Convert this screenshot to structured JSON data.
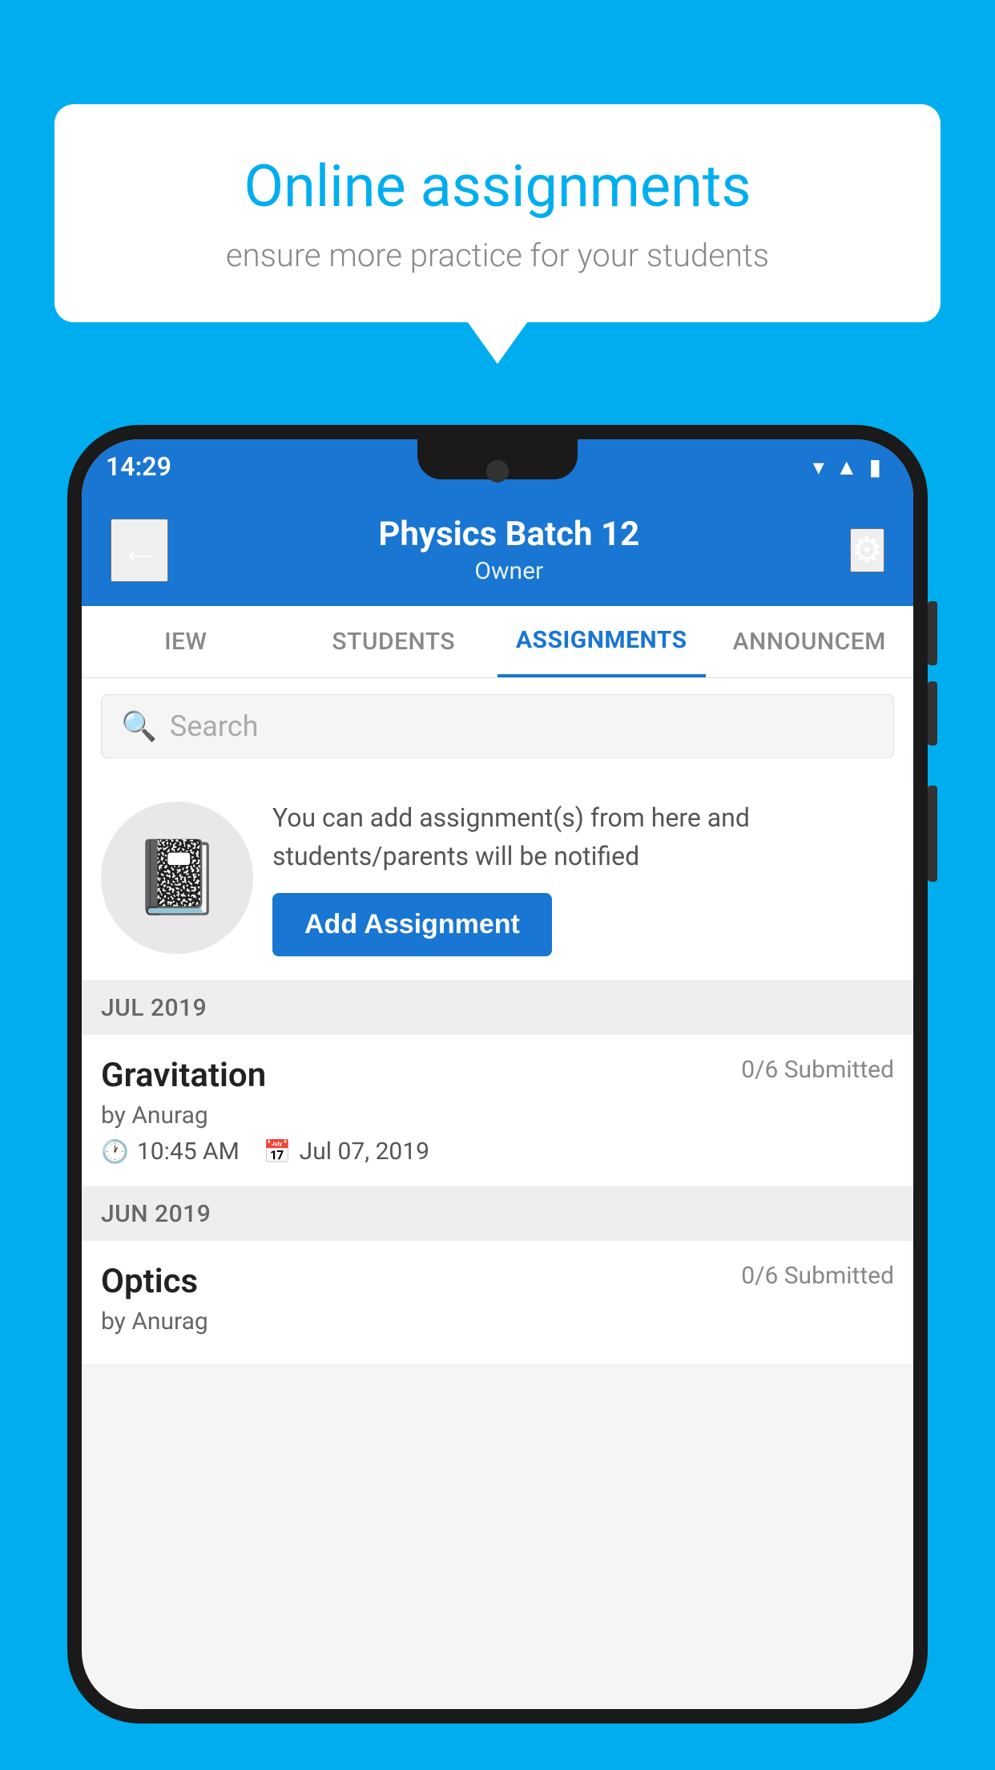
{
  "background_color": "#00AEEF",
  "speech_bubble": {
    "title": "Online assignments",
    "subtitle": "ensure more practice for your students"
  },
  "phone": {
    "status_bar": {
      "time": "14:29",
      "icons": [
        "wifi",
        "signal",
        "battery"
      ]
    },
    "app_bar": {
      "title": "Physics Batch 12",
      "subtitle": "Owner",
      "back_label": "←",
      "settings_label": "⚙"
    },
    "tabs": [
      {
        "label": "IEW",
        "active": false
      },
      {
        "label": "STUDENTS",
        "active": false
      },
      {
        "label": "ASSIGNMENTS",
        "active": true
      },
      {
        "label": "ANNOUNCEM",
        "active": false
      }
    ],
    "search": {
      "placeholder": "Search"
    },
    "promo": {
      "description": "You can add assignment(s) from here and students/parents will be notified",
      "button_label": "Add Assignment"
    },
    "sections": [
      {
        "month": "JUL 2019",
        "assignments": [
          {
            "name": "Gravitation",
            "submitted": "0/6 Submitted",
            "by": "by Anurag",
            "time": "10:45 AM",
            "date": "Jul 07, 2019"
          }
        ]
      },
      {
        "month": "JUN 2019",
        "assignments": [
          {
            "name": "Optics",
            "submitted": "0/6 Submitted",
            "by": "by Anurag",
            "time": "",
            "date": ""
          }
        ]
      }
    ]
  }
}
